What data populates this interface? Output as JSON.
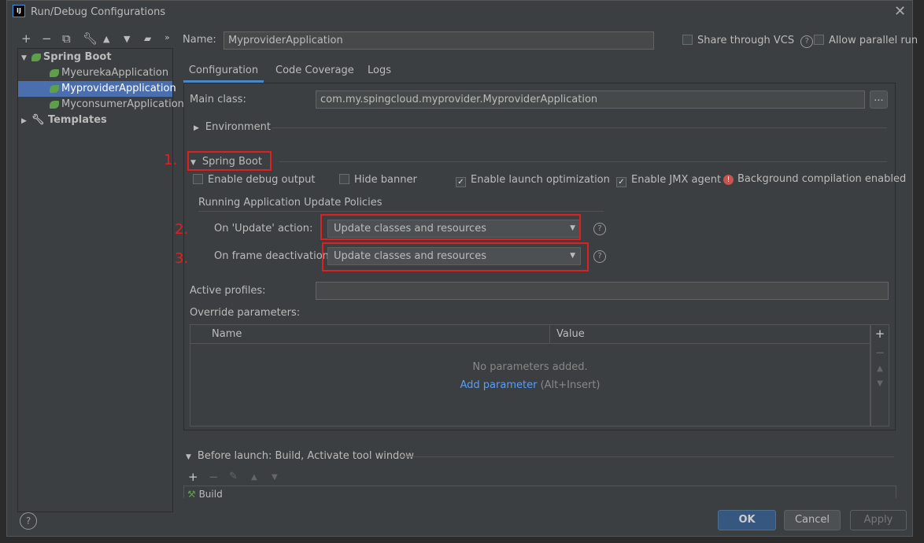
{
  "window": {
    "title": "Run/Debug Configurations",
    "logo": "IJ"
  },
  "toolbar": {
    "icons": [
      "plus-icon",
      "minus-icon",
      "copy-icon",
      "wrench-icon",
      "arrow-up-icon",
      "arrow-down-icon",
      "new-folder-icon",
      "more-icon"
    ]
  },
  "tree": {
    "group": "Spring Boot",
    "items": [
      "MyeurekaApplication",
      "MyproviderApplication",
      "MyconsumerApplication"
    ],
    "selected": "MyproviderApplication",
    "templates": "Templates"
  },
  "name": {
    "label": "Name:",
    "value": "MyproviderApplication"
  },
  "share_vcs": "Share through VCS",
  "allow_parallel": "Allow parallel run",
  "tabs": [
    "Configuration",
    "Code Coverage",
    "Logs"
  ],
  "main_class": {
    "label": "Main class:",
    "value": "com.my.spingcloud.myprovider.MyproviderApplication",
    "browse": "..."
  },
  "environment": "Environment",
  "spring_boot": {
    "header": "Spring Boot",
    "debug_output": "Enable debug output",
    "hide_banner": "Hide banner",
    "launch_opt": "Enable launch optimization",
    "jmx": "Enable JMX agent",
    "bg_compile": "Background compilation enabled",
    "checks": {
      "debug_output": false,
      "hide_banner": false,
      "launch_opt": true,
      "jmx": true
    }
  },
  "policies": {
    "header": "Running Application Update Policies",
    "update_label": "On 'Update' action:",
    "update_value": "Update classes and resources",
    "frame_label": "On frame deactivation:",
    "frame_value": "Update classes and resources"
  },
  "annotations": [
    "1.",
    "2.",
    "3."
  ],
  "active_profiles": {
    "label": "Active profiles:",
    "value": ""
  },
  "override": {
    "label": "Override parameters:",
    "columns": [
      "Name",
      "Value"
    ],
    "empty": "No parameters added.",
    "add_link": "Add parameter",
    "add_hint": "(Alt+Insert)"
  },
  "before_launch": {
    "header": "Before launch: Build, Activate tool window",
    "items": [
      "Build"
    ]
  },
  "buttons": {
    "ok": "OK",
    "cancel": "Cancel",
    "apply": "Apply",
    "help": "?"
  },
  "colors": {
    "accent": "#4b6eaf",
    "annotation": "#e02020",
    "link": "#589df6"
  }
}
